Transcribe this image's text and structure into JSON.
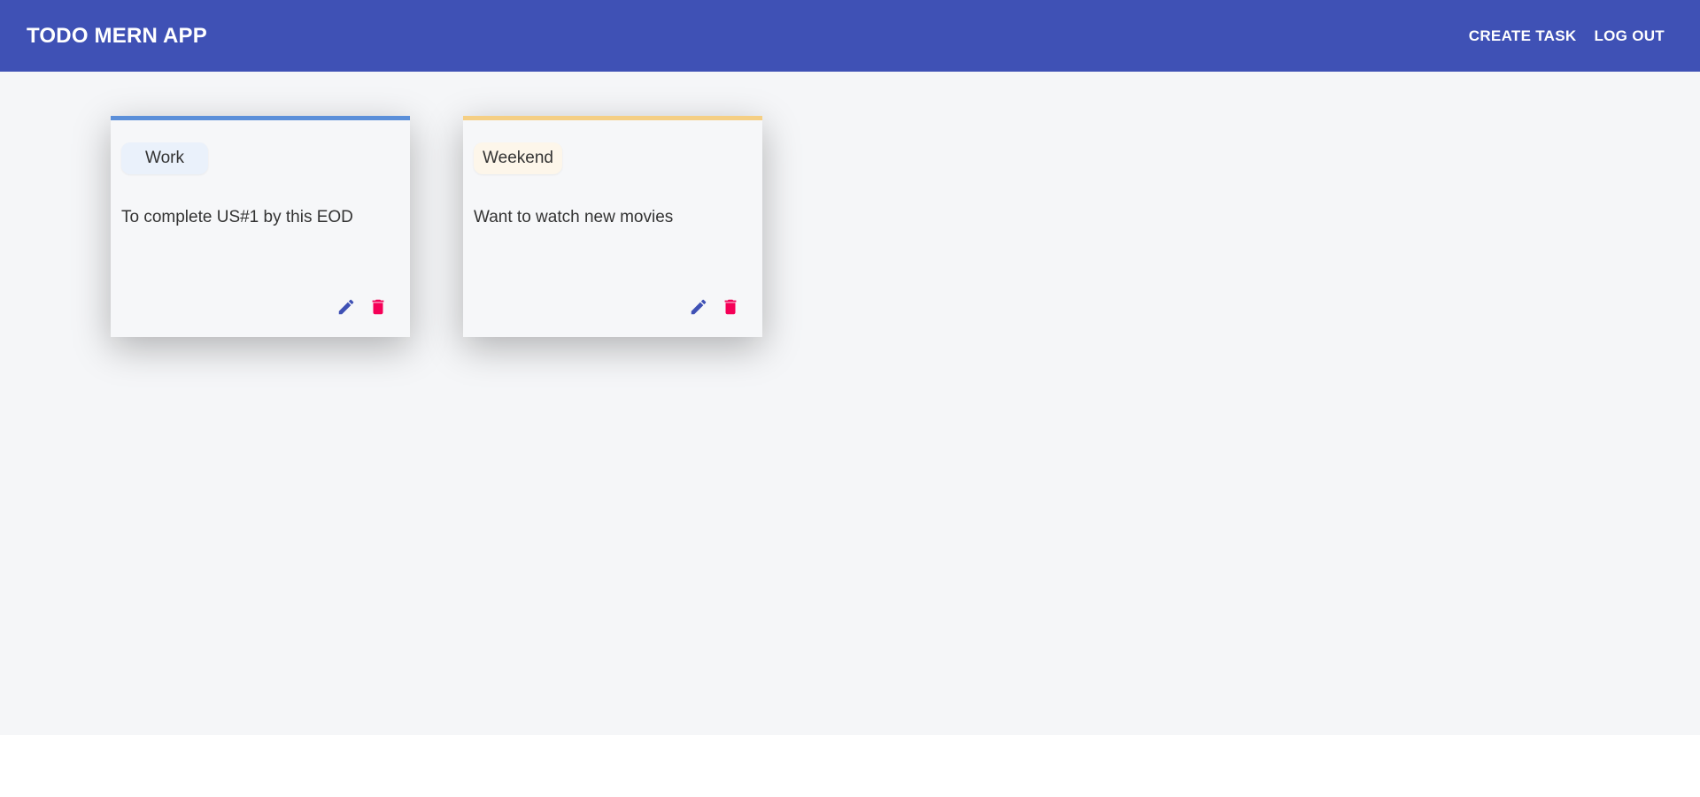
{
  "header": {
    "title": "TODO MERN APP",
    "create_task_label": "CREATE TASK",
    "logout_label": "LOG OUT"
  },
  "colors": {
    "app_bar": "#3f51b5",
    "edit_icon": "#3f51b5",
    "delete_icon": "#f50057"
  },
  "tasks": [
    {
      "category": "Work",
      "text": "To complete US#1 by this EOD",
      "accent_color": "#5b8fd9",
      "chip_bg": "#eaf1fb",
      "edit_icon": "pencil-icon",
      "delete_icon": "trash-icon"
    },
    {
      "category": "Weekend",
      "text": "Want to watch new movies",
      "accent_color": "#f5cf84",
      "chip_bg": "#fdf6ea",
      "edit_icon": "pencil-icon",
      "delete_icon": "trash-icon"
    }
  ]
}
